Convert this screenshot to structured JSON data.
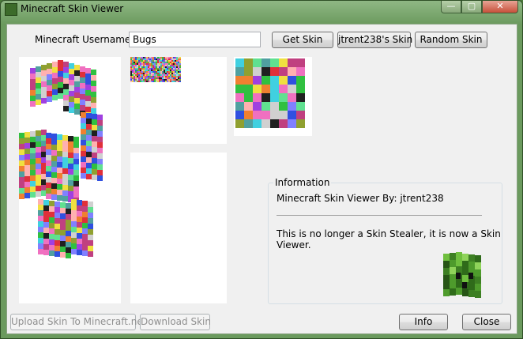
{
  "window": {
    "title": "Minecraft Skin Viewer",
    "min_label": "—",
    "max_label": "▢",
    "close_label": "✕"
  },
  "form": {
    "username_label": "Minecraft Username:",
    "username_value": "Bugs",
    "get_skin": "Get Skin",
    "jtrent_skin": "jtrent238's Skin",
    "random_skin": "Random Skin"
  },
  "info": {
    "group_title": "Information",
    "byline": "Minecraft Skin Viewer By: jtrent238",
    "message": "This is no longer a Skin Stealer, it is now a Skin Viewer."
  },
  "footer": {
    "upload": "Upload Skin To Minecraft.net",
    "download": "Download Skin",
    "info": "Info",
    "close": "Close"
  },
  "colors": {
    "window_frame": "#6b9a5e",
    "client_bg": "#f0f0f0",
    "preview_bg": "#ffffff"
  }
}
